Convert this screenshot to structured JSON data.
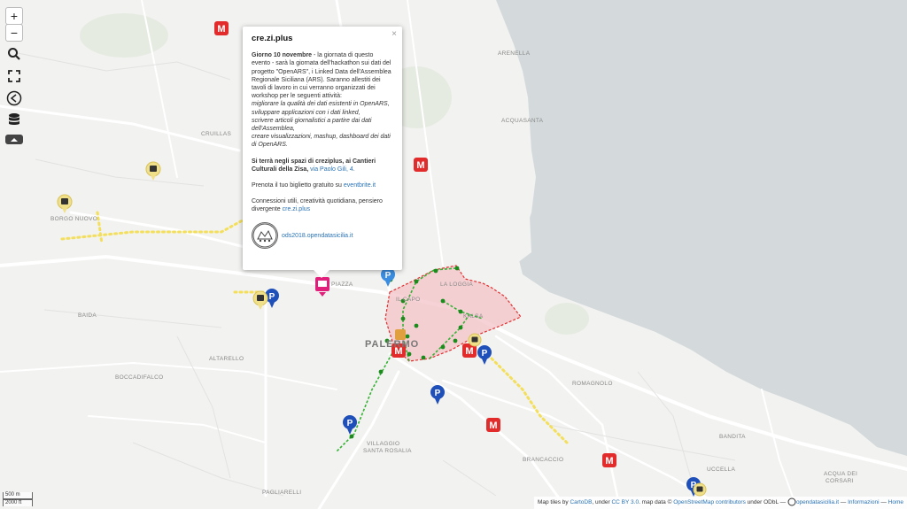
{
  "controls": {
    "zoom_in": "+",
    "zoom_out": "−"
  },
  "popup": {
    "title": "cre.zi.plus",
    "close": "×",
    "p1_bold": "Giorno 10 novembre",
    "p1_text": " - la giornata di questo evento - sarà la giornata dell'hackathon sui dati del progetto \"OpenARS\", i Linked Data dell'Assemblea Regionale Siciliana (ARS). Saranno allestiti dei tavoli di lavoro in cui verranno organizzati dei workshop per le seguenti attività:",
    "list": [
      "migliorare la qualità dei dati esistenti in OpenARS,",
      "sviluppare applicazioni con i dati linked,",
      "scrivere articoli giornalistici a partire dai dati dell'Assemblea,",
      "creare visualizzazioni, mashup, dashboard dei dati di OpenARS."
    ],
    "p2_bold": "Si terrà negli spazi di creziplus, ai Cantieri Culturali della Zisa, ",
    "p2_link": "via Paolo Gili, 4.",
    "p3_text": "Prenota il tuo biglietto gratuito su ",
    "p3_link": "eventbrite.it",
    "p4_text": "Connessioni utili, creatività quotidiana, pensiero divergente ",
    "p4_link": "cre.zi.plus",
    "footer_link": "ods2018.opendatasicilia.it"
  },
  "labels": {
    "arenella": "ARENELLA",
    "acquasanta": "ACQUASANTA",
    "cruillas": "CRUILLAS",
    "borgo_nuovo": "BORGO NUOVO",
    "baida": "BAIDA",
    "altarello": "ALTARELLO",
    "boccadifalco": "BOCCADIFALCO",
    "palermo": "PALERMO",
    "la_loggia": "LA LOGGIA",
    "il_capo": "IL CAPO",
    "kalsa": "KALSA",
    "romagnolo": "ROMAGNOLO",
    "villaggio": "VILLAGGIO",
    "santa_rosalia": "SANTA ROSALIA",
    "brancaccio": "BRANCACCIO",
    "bandita": "BANDITA",
    "acqua_dei": "ACQUA DEI",
    "corsari": "CORSARI",
    "pagliarelli": "PAGLIARELLI",
    "uccella": "UCCELLA",
    "piazza": "PIAZZA"
  },
  "scale": {
    "metric": "500 m",
    "imperial": "2000 ft"
  },
  "attribution": {
    "t1": "Map tiles by ",
    "l1": "CartoDB",
    "t2": ", under ",
    "l2": "CC BY 3.0",
    "t3": ". map data © ",
    "l3": "OpenStreetMap contributors",
    "t4": " under ODbL — ",
    "l4": "opendatasicilia.it",
    "t5": " — ",
    "l5": "Informazioni",
    "t6": " — ",
    "l6": "Home"
  },
  "colors": {
    "sea": "#d4dadc",
    "land": "#f2f2f0",
    "zone_fill": "#f4c6ca",
    "zone_border": "#e03030",
    "route": "#35b135",
    "stop": "#1c8a1c",
    "marker_red": "#e22c2c",
    "marker_blue": "#1f4fb8",
    "marker_yellow": "#f1e08a",
    "marker_pink": "#e0207a"
  },
  "markers": {
    "metro": "metro-marker",
    "parking": "parking-marker",
    "bus": "bus-marker",
    "event": "event-marker"
  }
}
